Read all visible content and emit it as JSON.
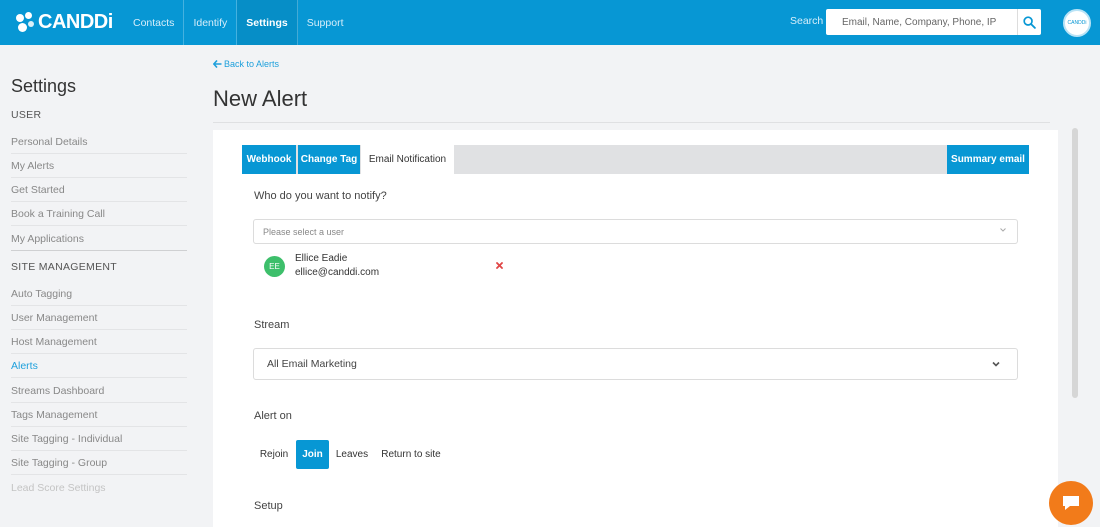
{
  "app": {
    "brand": "CANDDi",
    "avatar_text": "CANDDi"
  },
  "nav": {
    "items": [
      {
        "label": "Contacts"
      },
      {
        "label": "Identify"
      },
      {
        "label": "Settings",
        "active": true
      },
      {
        "label": "Support"
      }
    ]
  },
  "search": {
    "label": "Search",
    "placeholder": "Email, Name, Company, Phone, IP"
  },
  "sidebar": {
    "title": "Settings",
    "user_section": "USER",
    "user_items": [
      "Personal Details",
      "My Alerts",
      "Get Started",
      "Book a Training Call",
      "My Applications"
    ],
    "site_section": "SITE MANAGEMENT",
    "site_items": [
      "Auto Tagging",
      "User Management",
      "Host Management",
      "Alerts",
      "Streams Dashboard",
      "Tags Management",
      "Site Tagging - Individual",
      "Site Tagging - Group",
      "Lead Score Settings"
    ],
    "active_item": "Alerts"
  },
  "main": {
    "back_link": "Back to Alerts",
    "title": "New Alert"
  },
  "tabs": {
    "webhook": "Webhook",
    "change_tag": "Change Tag",
    "email_notification": "Email Notification",
    "summary_email": "Summary email"
  },
  "notify": {
    "question": "Who do you want to notify?",
    "placeholder": "Please select a user",
    "selected_user": {
      "initials": "EE",
      "name": "Ellice Eadie",
      "email": "ellice@canddi.com"
    }
  },
  "stream": {
    "label": "Stream",
    "value": "All Email Marketing"
  },
  "alert_on": {
    "label": "Alert on",
    "options": [
      "Rejoin",
      "Join",
      "Leaves",
      "Return to site"
    ],
    "selected": "Join"
  },
  "setup": {
    "label": "Setup"
  },
  "colors": {
    "primary": "#0797d4",
    "accent_link": "#1ea0dc",
    "avatar_green": "#3dbf6b",
    "remove_red": "#e04646",
    "chat_orange": "#f27b1a"
  }
}
